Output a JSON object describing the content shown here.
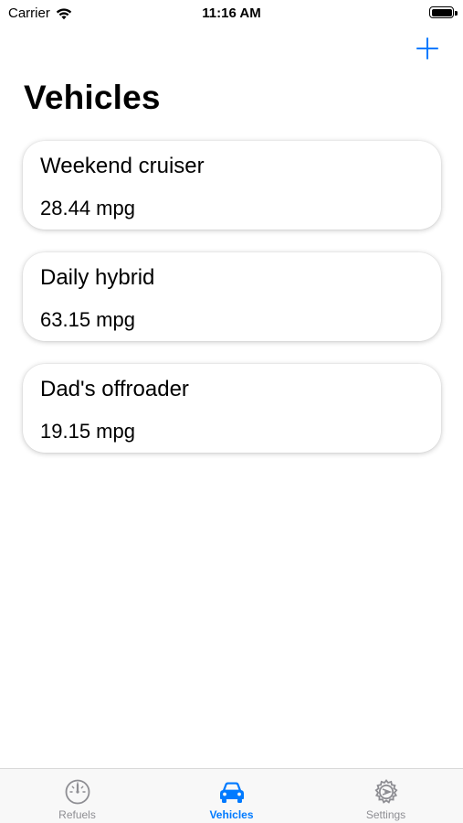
{
  "status_bar": {
    "carrier": "Carrier",
    "time": "11:16 AM",
    "battery_level": 1.0
  },
  "nav": {
    "add_icon": "plus-icon",
    "title": "Vehicles",
    "accent_color": "#007aff"
  },
  "vehicles": [
    {
      "name": "Weekend cruiser",
      "efficiency": "28.44 mpg"
    },
    {
      "name": "Daily hybrid",
      "efficiency": "63.15 mpg"
    },
    {
      "name": "Dad's offroader",
      "efficiency": "19.15 mpg"
    }
  ],
  "tab_bar": {
    "tabs": [
      {
        "label": "Refuels",
        "icon": "gauge-icon",
        "active": false
      },
      {
        "label": "Vehicles",
        "icon": "car-icon",
        "active": true
      },
      {
        "label": "Settings",
        "icon": "gear-icon",
        "active": false
      }
    ],
    "active_color": "#007aff",
    "inactive_color": "#8e8e93"
  }
}
